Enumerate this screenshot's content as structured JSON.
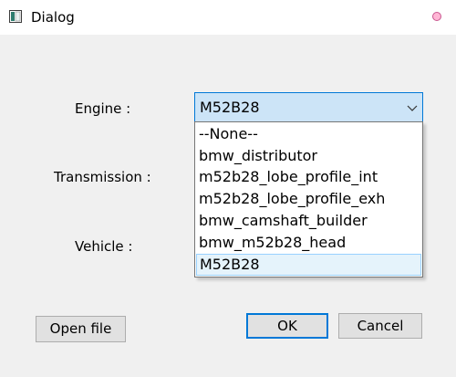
{
  "window": {
    "title": "Dialog"
  },
  "form": {
    "engine_label": "Engine :",
    "transmission_label": "Transmission :",
    "vehicle_label": "Vehicle :"
  },
  "engine_combo": {
    "selected": "M52B28",
    "options": [
      "--None--",
      "bmw_distributor",
      "m52b28_lobe_profile_int",
      "m52b28_lobe_profile_exh",
      "bmw_camshaft_builder",
      "bmw_m52b28_head",
      "M52B28"
    ]
  },
  "buttons": {
    "open_file": "Open file",
    "ok": "OK",
    "cancel": "Cancel"
  },
  "colors": {
    "accent": "#0078d7",
    "combo_bg": "#cce4f7",
    "selected_option_bg": "#e5f3fb"
  }
}
